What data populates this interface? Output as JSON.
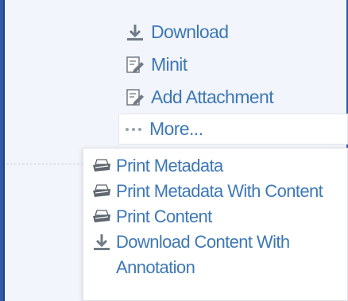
{
  "actions": [
    {
      "label": "Download",
      "icon": "download-icon"
    },
    {
      "label": "Minit",
      "icon": "edit-note-icon"
    },
    {
      "label": "Add Attachment",
      "icon": "edit-note-icon"
    },
    {
      "label": "More...",
      "icon": "more-dots-icon"
    }
  ],
  "dropdown": {
    "items": [
      {
        "label": "Print Metadata",
        "icon": "printer-icon"
      },
      {
        "label": "Print Metadata With Content",
        "icon": "printer-icon"
      },
      {
        "label": "Print Content",
        "icon": "printer-icon"
      },
      {
        "label": "Download Content With Annotation",
        "icon": "download-icon"
      }
    ]
  }
}
